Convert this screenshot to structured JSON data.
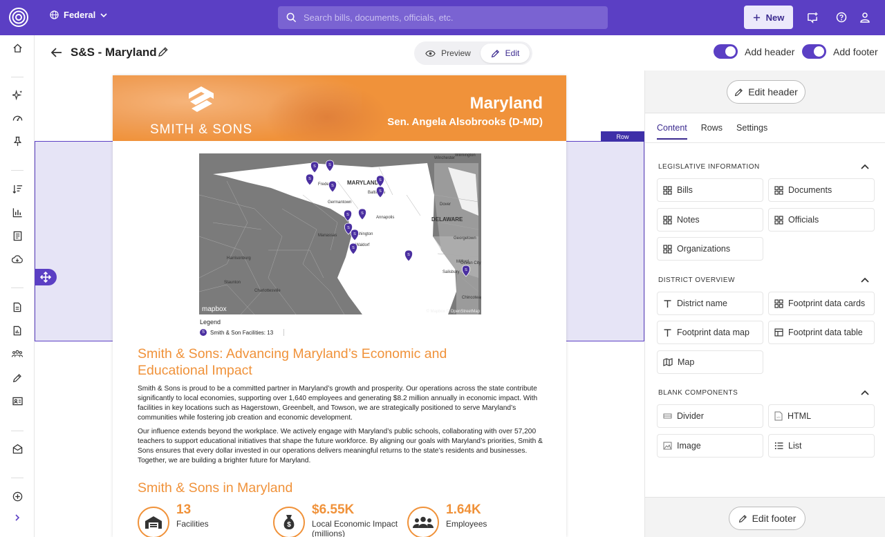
{
  "topbar": {
    "jurisdiction": "Federal",
    "search_placeholder": "Search bills, documents, officials, etc.",
    "new_label": "New"
  },
  "editor": {
    "title": "S&S - Maryland",
    "preview_label": "Preview",
    "edit_label": "Edit",
    "add_header_label": "Add header",
    "add_footer_label": "Add footer",
    "row_tag": "Row"
  },
  "document": {
    "brand_name": "SMITH & SONS",
    "state_name": "Maryland",
    "senator": "Sen. Angela Alsobrooks (D-MD)",
    "map": {
      "state_label": "MARYLAND",
      "delaware_label": "DELAWARE",
      "places": [
        "Frederick",
        "Baltimore",
        "Germantown",
        "Annapolis",
        "Washington",
        "Waldorf",
        "Dover",
        "Salisbury",
        "Harrisonburg",
        "Staunton",
        "Charlottesville",
        "Georgetown",
        "Milford",
        "Ocean City",
        "Winchester",
        "Wilmington",
        "Chincoteague",
        "Manassas"
      ],
      "attribution": "© Mapbox © OpenStreetMap",
      "logo_text": "mapbox",
      "pin_glyph": "S"
    },
    "legend_title": "Legend",
    "legend_item": "Smith & Son Facilities: 13",
    "heading": "Smith & Sons: Advancing Maryland’s Economic and Educational Impact",
    "para1": "Smith & Sons is proud to be a committed partner in Maryland’s growth and prosperity. Our operations across the state contribute significantly to local economies, supporting over 1,640 employees and generating $8.2 million annually in economic impact. With facilities in key locations such as Hagerstown, Greenbelt, and Towson, we are strategically positioned to serve Maryland’s communities while fostering job creation and economic development.",
    "para2": "Our influence extends beyond the workplace. We actively engage with Maryland’s public schools, collaborating with over 57,200 teachers to support educational initiatives that shape the future workforce. By aligning our goals with Maryland’s priorities, Smith & Sons ensures that every dollar invested in our operations delivers meaningful returns to the state’s residents and businesses. Together, we are building a brighter future for Maryland.",
    "section2": "Smith & Sons in Maryland",
    "stats": [
      {
        "value": "13",
        "label": "Facilities"
      },
      {
        "value": "$6.55K",
        "label": "Local Economic Impact (millions)"
      },
      {
        "value": "1.64K",
        "label": "Employees"
      }
    ]
  },
  "panel": {
    "edit_header": "Edit header",
    "edit_footer": "Edit footer",
    "tabs": [
      "Content",
      "Rows",
      "Settings"
    ],
    "sections": [
      {
        "title": "LEGISLATIVE INFORMATION",
        "items": [
          "Bills",
          "Documents",
          "Notes",
          "Officials",
          "Organizations"
        ]
      },
      {
        "title": "DISTRICT OVERVIEW",
        "items": [
          "District name",
          "Footprint data cards",
          "Footprint data map",
          "Footprint data table",
          "Map"
        ]
      },
      {
        "title": "BLANK COMPONENTS",
        "items": [
          "Divider",
          "HTML",
          "Image",
          "List"
        ]
      }
    ]
  },
  "colors": {
    "brand": "#5b3fc4",
    "accent_orange": "#f0923a"
  }
}
